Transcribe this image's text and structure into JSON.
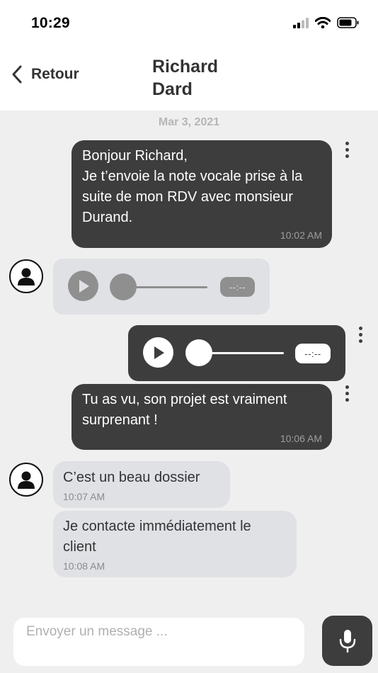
{
  "status_bar": {
    "time": "10:29"
  },
  "header": {
    "back_label": "Retour",
    "contact_name": "Richard Dard"
  },
  "chat": {
    "date": "Mar 3, 2021",
    "messages": [
      {
        "direction": "out",
        "text": "Bonjour Richard,\nJe t’envoie la note vocale prise à la suite de mon RDV avec monsieur Durand.",
        "time": "10:02 AM"
      },
      {
        "direction": "in",
        "type": "audio",
        "duration": "--:--"
      },
      {
        "direction": "out",
        "type": "audio",
        "duration": "--:--"
      },
      {
        "direction": "out",
        "text": "Tu as vu, son projet est vraiment surprenant !",
        "time": "10:06 AM"
      },
      {
        "direction": "in",
        "text": "C’est un beau dossier",
        "time": "10:07 AM"
      },
      {
        "direction": "in",
        "text": "Je contacte immédiatement le client",
        "time": "10:08 AM"
      }
    ]
  },
  "composer": {
    "placeholder": "Envoyer un message ..."
  },
  "icons": {
    "back": "chevron-left-icon",
    "more": "more-vertical-icon",
    "avatar": "user-icon",
    "play": "play-icon",
    "mic": "microphone-icon",
    "signal": "signal-icon",
    "wifi": "wifi-icon",
    "battery": "battery-icon"
  },
  "colors": {
    "outgoing_bubble": "#3d3d3d",
    "incoming_bubble": "#dfe1e5",
    "background": "#efefef"
  }
}
